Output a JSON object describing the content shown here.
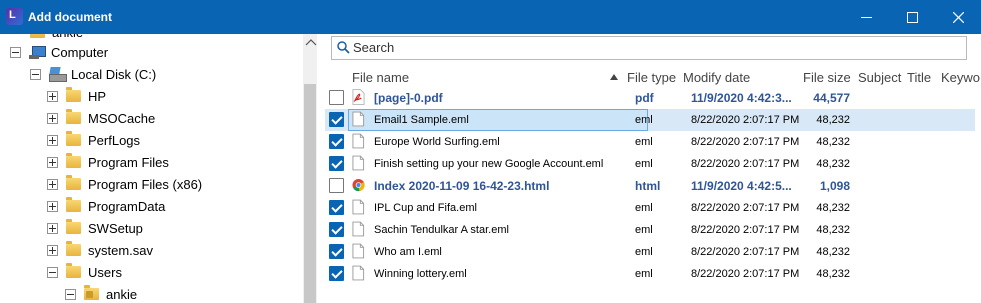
{
  "window": {
    "title": "Add document",
    "app_icon_letter": "L"
  },
  "tree": {
    "partial_top_label": "ankie",
    "computer": "Computer",
    "local_disk": "Local Disk (C:)",
    "folders": [
      "HP",
      "MSOCache",
      "PerfLogs",
      "Program Files",
      "Program Files (x86)",
      "ProgramData",
      "SWSetup",
      "system.sav",
      "Users"
    ],
    "user": "ankie"
  },
  "search": {
    "placeholder": "Search"
  },
  "columns": {
    "name": "File name",
    "type": "File type",
    "date": "Modify date",
    "size": "File size",
    "subject": "Subject",
    "title": "Title",
    "keywords": "Keywo"
  },
  "files": [
    {
      "name": "[page]-0.pdf",
      "type": "pdf",
      "date": "11/9/2020 4:42:3...",
      "size": "44,577",
      "checked": false,
      "icon": "pdf-icon",
      "bold": true
    },
    {
      "name": "Email1 Sample.eml",
      "type": "eml",
      "date": "8/22/2020 2:07:17 PM",
      "size": "48,232",
      "checked": true,
      "icon": "document-icon",
      "bold": false,
      "selected": true
    },
    {
      "name": "Europe World Surfing.eml",
      "type": "eml",
      "date": "8/22/2020 2:07:17 PM",
      "size": "48,232",
      "checked": true,
      "icon": "document-icon",
      "bold": false
    },
    {
      "name": "Finish setting up your new Google Account.eml",
      "type": "eml",
      "date": "8/22/2020 2:07:17 PM",
      "size": "48,232",
      "checked": true,
      "icon": "document-icon",
      "bold": false
    },
    {
      "name": "Index 2020-11-09 16-42-23.html",
      "type": "html",
      "date": "11/9/2020 4:42:5...",
      "size": "1,098",
      "checked": false,
      "icon": "chrome-icon",
      "bold": true
    },
    {
      "name": "IPL Cup and Fifa.eml",
      "type": "eml",
      "date": "8/22/2020 2:07:17 PM",
      "size": "48,232",
      "checked": true,
      "icon": "document-icon",
      "bold": false
    },
    {
      "name": "Sachin Tendulkar A star.eml",
      "type": "eml",
      "date": "8/22/2020 2:07:17 PM",
      "size": "48,232",
      "checked": true,
      "icon": "document-icon",
      "bold": false
    },
    {
      "name": "Who am I.eml",
      "type": "eml",
      "date": "8/22/2020 2:07:17 PM",
      "size": "48,232",
      "checked": true,
      "icon": "document-icon",
      "bold": false
    },
    {
      "name": "Winning lottery.eml",
      "type": "eml",
      "date": "8/22/2020 2:07:17 PM",
      "size": "48,232",
      "checked": true,
      "icon": "document-icon",
      "bold": false
    }
  ],
  "colors": {
    "titlebar": "#0a64b4",
    "accent_link": "#2f5597",
    "selection": "#cce4f7"
  }
}
